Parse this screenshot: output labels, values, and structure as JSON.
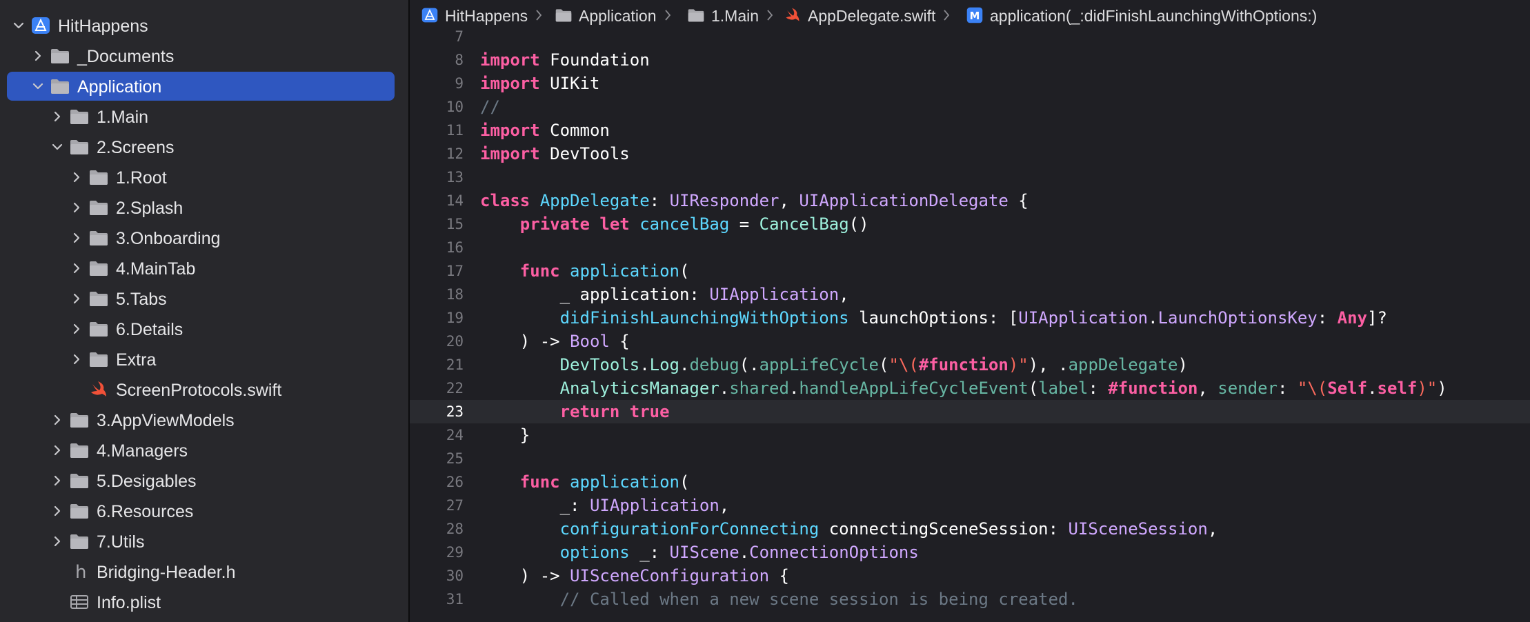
{
  "navigator": {
    "items": [
      {
        "label": "HitHappens",
        "depth": 0,
        "icon": "project-icon",
        "disclosure": "open",
        "selected": false
      },
      {
        "label": "_Documents",
        "depth": 1,
        "icon": "folder-icon",
        "disclosure": "closed",
        "selected": false
      },
      {
        "label": "Application",
        "depth": 1,
        "icon": "folder-icon",
        "disclosure": "open",
        "selected": true
      },
      {
        "label": "1.Main",
        "depth": 2,
        "icon": "folder-icon",
        "disclosure": "closed",
        "selected": false
      },
      {
        "label": "2.Screens",
        "depth": 2,
        "icon": "folder-icon",
        "disclosure": "open",
        "selected": false
      },
      {
        "label": "1.Root",
        "depth": 3,
        "icon": "folder-icon",
        "disclosure": "closed",
        "selected": false
      },
      {
        "label": "2.Splash",
        "depth": 3,
        "icon": "folder-icon",
        "disclosure": "closed",
        "selected": false
      },
      {
        "label": "3.Onboarding",
        "depth": 3,
        "icon": "folder-icon",
        "disclosure": "closed",
        "selected": false
      },
      {
        "label": "4.MainTab",
        "depth": 3,
        "icon": "folder-icon",
        "disclosure": "closed",
        "selected": false
      },
      {
        "label": "5.Tabs",
        "depth": 3,
        "icon": "folder-icon",
        "disclosure": "closed",
        "selected": false
      },
      {
        "label": "6.Details",
        "depth": 3,
        "icon": "folder-icon",
        "disclosure": "closed",
        "selected": false
      },
      {
        "label": "Extra",
        "depth": 3,
        "icon": "folder-icon",
        "disclosure": "closed",
        "selected": false
      },
      {
        "label": "ScreenProtocols.swift",
        "depth": 3,
        "icon": "swift-file-icon",
        "disclosure": "none",
        "selected": false
      },
      {
        "label": "3.AppViewModels",
        "depth": 2,
        "icon": "folder-icon",
        "disclosure": "closed",
        "selected": false
      },
      {
        "label": "4.Managers",
        "depth": 2,
        "icon": "folder-icon",
        "disclosure": "closed",
        "selected": false
      },
      {
        "label": "5.Desigables",
        "depth": 2,
        "icon": "folder-icon",
        "disclosure": "closed",
        "selected": false
      },
      {
        "label": "6.Resources",
        "depth": 2,
        "icon": "folder-icon",
        "disclosure": "closed",
        "selected": false
      },
      {
        "label": "7.Utils",
        "depth": 2,
        "icon": "folder-icon",
        "disclosure": "closed",
        "selected": false
      },
      {
        "label": "Bridging-Header.h",
        "depth": 2,
        "icon": "header-file-icon",
        "disclosure": "none",
        "selected": false
      },
      {
        "label": "Info.plist",
        "depth": 2,
        "icon": "plist-file-icon",
        "disclosure": "none",
        "selected": false
      }
    ]
  },
  "jumpbar": {
    "crumbs": [
      {
        "label": "HitHappens",
        "icon": "project-icon"
      },
      {
        "label": "Application",
        "icon": "folder-icon"
      },
      {
        "label": "1.Main",
        "icon": "folder-icon"
      },
      {
        "label": "AppDelegate.swift",
        "icon": "swift-file-icon"
      },
      {
        "label": "application(_:didFinishLaunchingWithOptions:)",
        "icon": "method-icon"
      }
    ]
  },
  "editor": {
    "current_line": 23,
    "lines": [
      {
        "n": "7",
        "tokens": []
      },
      {
        "n": "8",
        "tokens": [
          [
            "kw",
            "import"
          ],
          [
            "plain",
            " Foundation"
          ]
        ]
      },
      {
        "n": "9",
        "tokens": [
          [
            "kw",
            "import"
          ],
          [
            "plain",
            " UIKit"
          ]
        ]
      },
      {
        "n": "10",
        "tokens": [
          [
            "cmt",
            "//"
          ]
        ]
      },
      {
        "n": "11",
        "tokens": [
          [
            "kw",
            "import"
          ],
          [
            "plain",
            " Common"
          ]
        ]
      },
      {
        "n": "12",
        "tokens": [
          [
            "kw",
            "import"
          ],
          [
            "plain",
            " DevTools"
          ]
        ]
      },
      {
        "n": "13",
        "tokens": []
      },
      {
        "n": "14",
        "tokens": [
          [
            "kw",
            "class"
          ],
          [
            "plain",
            " "
          ],
          [
            "decl",
            "AppDelegate"
          ],
          [
            "plain",
            ": "
          ],
          [
            "type",
            "UIResponder"
          ],
          [
            "plain",
            ", "
          ],
          [
            "type",
            "UIApplicationDelegate"
          ],
          [
            "plain",
            " {"
          ]
        ]
      },
      {
        "n": "15",
        "tokens": [
          [
            "plain",
            "    "
          ],
          [
            "kw",
            "private"
          ],
          [
            "plain",
            " "
          ],
          [
            "kw",
            "let"
          ],
          [
            "plain",
            " "
          ],
          [
            "decl",
            "cancelBag"
          ],
          [
            "plain",
            " = "
          ],
          [
            "tealproj",
            "CancelBag"
          ],
          [
            "plain",
            "()"
          ]
        ]
      },
      {
        "n": "16",
        "tokens": []
      },
      {
        "n": "17",
        "tokens": [
          [
            "plain",
            "    "
          ],
          [
            "kw",
            "func"
          ],
          [
            "plain",
            " "
          ],
          [
            "decl",
            "application"
          ],
          [
            "plain",
            "("
          ]
        ]
      },
      {
        "n": "18",
        "tokens": [
          [
            "plain",
            "        _ application: "
          ],
          [
            "type",
            "UIApplication"
          ],
          [
            "plain",
            ","
          ]
        ]
      },
      {
        "n": "19",
        "tokens": [
          [
            "plain",
            "        "
          ],
          [
            "decl",
            "didFinishLaunchingWithOptions"
          ],
          [
            "plain",
            " launchOptions: ["
          ],
          [
            "type",
            "UIApplication"
          ],
          [
            "plain",
            "."
          ],
          [
            "type",
            "LaunchOptionsKey"
          ],
          [
            "plain",
            ": "
          ],
          [
            "kw",
            "Any"
          ],
          [
            "plain",
            "]?"
          ]
        ]
      },
      {
        "n": "20",
        "tokens": [
          [
            "plain",
            "    ) -> "
          ],
          [
            "type",
            "Bool"
          ],
          [
            "plain",
            " {"
          ]
        ]
      },
      {
        "n": "21",
        "tokens": [
          [
            "plain",
            "        "
          ],
          [
            "tealproj",
            "DevTools"
          ],
          [
            "plain",
            "."
          ],
          [
            "tealproj",
            "Log"
          ],
          [
            "plain",
            "."
          ],
          [
            "proj",
            "debug"
          ],
          [
            "plain",
            "(."
          ],
          [
            "proj",
            "appLifeCycle"
          ],
          [
            "plain",
            "("
          ],
          [
            "str",
            "\"\\("
          ],
          [
            "kw",
            "#function"
          ],
          [
            "str",
            ")\""
          ],
          [
            "plain",
            "), ."
          ],
          [
            "proj",
            "appDelegate"
          ],
          [
            "plain",
            ")"
          ]
        ]
      },
      {
        "n": "22",
        "tokens": [
          [
            "plain",
            "        "
          ],
          [
            "tealproj",
            "AnalyticsManager"
          ],
          [
            "plain",
            "."
          ],
          [
            "proj",
            "shared"
          ],
          [
            "plain",
            "."
          ],
          [
            "proj",
            "handleAppLifeCycleEvent"
          ],
          [
            "plain",
            "("
          ],
          [
            "proj",
            "label"
          ],
          [
            "plain",
            ": "
          ],
          [
            "kw",
            "#function"
          ],
          [
            "plain",
            ", "
          ],
          [
            "proj",
            "sender"
          ],
          [
            "plain",
            ": "
          ],
          [
            "str",
            "\"\\("
          ],
          [
            "kw",
            "Self"
          ],
          [
            "plain",
            "."
          ],
          [
            "kw",
            "self"
          ],
          [
            "str",
            ")\""
          ],
          [
            "plain",
            ")"
          ]
        ]
      },
      {
        "n": "23",
        "tokens": [
          [
            "plain",
            "        "
          ],
          [
            "kw",
            "return"
          ],
          [
            "plain",
            " "
          ],
          [
            "kw",
            "true"
          ]
        ]
      },
      {
        "n": "24",
        "tokens": [
          [
            "plain",
            "    }"
          ]
        ]
      },
      {
        "n": "25",
        "tokens": []
      },
      {
        "n": "26",
        "tokens": [
          [
            "plain",
            "    "
          ],
          [
            "kw",
            "func"
          ],
          [
            "plain",
            " "
          ],
          [
            "decl",
            "application"
          ],
          [
            "plain",
            "("
          ]
        ]
      },
      {
        "n": "27",
        "tokens": [
          [
            "plain",
            "        _: "
          ],
          [
            "type",
            "UIApplication"
          ],
          [
            "plain",
            ","
          ]
        ]
      },
      {
        "n": "28",
        "tokens": [
          [
            "plain",
            "        "
          ],
          [
            "decl",
            "configurationForConnecting"
          ],
          [
            "plain",
            " connectingSceneSession: "
          ],
          [
            "type",
            "UISceneSession"
          ],
          [
            "plain",
            ","
          ]
        ]
      },
      {
        "n": "29",
        "tokens": [
          [
            "plain",
            "        "
          ],
          [
            "decl",
            "options"
          ],
          [
            "plain",
            " _: "
          ],
          [
            "type",
            "UIScene"
          ],
          [
            "plain",
            "."
          ],
          [
            "type",
            "ConnectionOptions"
          ]
        ]
      },
      {
        "n": "30",
        "tokens": [
          [
            "plain",
            "    ) -> "
          ],
          [
            "type",
            "UISceneConfiguration"
          ],
          [
            "plain",
            " {"
          ]
        ]
      },
      {
        "n": "31",
        "tokens": [
          [
            "plain",
            "        "
          ],
          [
            "cmt",
            "// Called when a new scene session is being created."
          ]
        ]
      }
    ]
  },
  "colors": {
    "selection": "#2f57c0",
    "keyword": "#fc5fa3",
    "type": "#d0a8ff",
    "declaration": "#5dd8ff",
    "project_symbol": "#67b7a4",
    "string": "#fc6a5d",
    "comment": "#6c7986"
  }
}
